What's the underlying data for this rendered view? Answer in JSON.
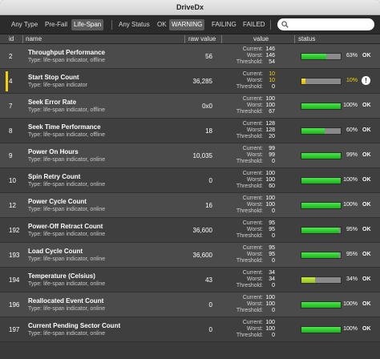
{
  "window": {
    "title": "DriveDx"
  },
  "toolbar": {
    "filters": [
      {
        "label": "Any Type",
        "active": false
      },
      {
        "label": "Pre-Fail",
        "active": false
      },
      {
        "label": "Life-Span",
        "active": true
      },
      {
        "label": "Any Status",
        "active": false
      },
      {
        "label": "OK",
        "active": false
      },
      {
        "label": "WARNING",
        "active": true
      },
      {
        "label": "FAILING",
        "active": false
      },
      {
        "label": "FAILED",
        "active": false
      }
    ],
    "search": {
      "value": "",
      "placeholder": ""
    }
  },
  "columns": {
    "id": "id",
    "name": "name",
    "raw": "raw value",
    "value": "value",
    "status": "status"
  },
  "labels": {
    "current": "Current:",
    "worst": "Worst:",
    "threshold": "Threshold:"
  },
  "colors": {
    "ok_green": "#22c422",
    "warning_yellow": "#f3d200",
    "track": "#8a8a8a"
  },
  "rows": [
    {
      "id": "2",
      "name": "Throughput Performance",
      "type": "Type: life-span indicator, offline",
      "raw": "56",
      "current": "146",
      "worst": "146",
      "threshold": "54",
      "percent": 63,
      "percent_label": "63%",
      "status": "OK",
      "level": "ok"
    },
    {
      "id": "4",
      "name": "Start Stop Count",
      "type": "Type: life-span indicator",
      "raw": "36,285",
      "current": "10",
      "worst": "10",
      "threshold": "0",
      "percent": 10,
      "percent_label": "10%",
      "status": "!",
      "level": "warning"
    },
    {
      "id": "7",
      "name": "Seek Error Rate",
      "type": "Type: life-span indicator, offline",
      "raw": "0x0",
      "current": "100",
      "worst": "100",
      "threshold": "67",
      "percent": 100,
      "percent_label": "100%",
      "status": "OK",
      "level": "ok"
    },
    {
      "id": "8",
      "name": "Seek Time Performance",
      "type": "Type: life-span indicator, offline",
      "raw": "18",
      "current": "128",
      "worst": "128",
      "threshold": "20",
      "percent": 60,
      "percent_label": "60%",
      "status": "OK",
      "level": "ok"
    },
    {
      "id": "9",
      "name": "Power On Hours",
      "type": "Type: life-span indicator, online",
      "raw": "10,035",
      "current": "99",
      "worst": "99",
      "threshold": "0",
      "percent": 99,
      "percent_label": "99%",
      "status": "OK",
      "level": "ok"
    },
    {
      "id": "10",
      "name": "Spin Retry Count",
      "type": "Type: life-span indicator, online",
      "raw": "0",
      "current": "100",
      "worst": "100",
      "threshold": "60",
      "percent": 100,
      "percent_label": "100%",
      "status": "OK",
      "level": "ok"
    },
    {
      "id": "12",
      "name": "Power Cycle Count",
      "type": "Type: life-span indicator, online",
      "raw": "16",
      "current": "100",
      "worst": "100",
      "threshold": "0",
      "percent": 100,
      "percent_label": "100%",
      "status": "OK",
      "level": "ok"
    },
    {
      "id": "192",
      "name": "Power-Off Retract Count",
      "type": "Type: life-span indicator, online",
      "raw": "36,600",
      "current": "95",
      "worst": "95",
      "threshold": "0",
      "percent": 95,
      "percent_label": "95%",
      "status": "OK",
      "level": "ok"
    },
    {
      "id": "193",
      "name": "Load Cycle Count",
      "type": "Type: life-span indicator, online",
      "raw": "36,600",
      "current": "95",
      "worst": "95",
      "threshold": "0",
      "percent": 95,
      "percent_label": "95%",
      "status": "OK",
      "level": "ok"
    },
    {
      "id": "194",
      "name": "Temperature (Celsius)",
      "type": "Type: life-span indicator, online",
      "raw": "43",
      "current": "34",
      "worst": "34",
      "threshold": "0",
      "percent": 34,
      "percent_label": "34%",
      "status": "OK",
      "level": "mid"
    },
    {
      "id": "196",
      "name": "Reallocated Event Count",
      "type": "Type: life-span indicator, online",
      "raw": "0",
      "current": "100",
      "worst": "100",
      "threshold": "0",
      "percent": 100,
      "percent_label": "100%",
      "status": "OK",
      "level": "ok"
    },
    {
      "id": "197",
      "name": "Current Pending Sector Count",
      "type": "Type: life-span indicator, online",
      "raw": "0",
      "current": "100",
      "worst": "100",
      "threshold": "0",
      "percent": 100,
      "percent_label": "100%",
      "status": "OK",
      "level": "ok"
    }
  ]
}
